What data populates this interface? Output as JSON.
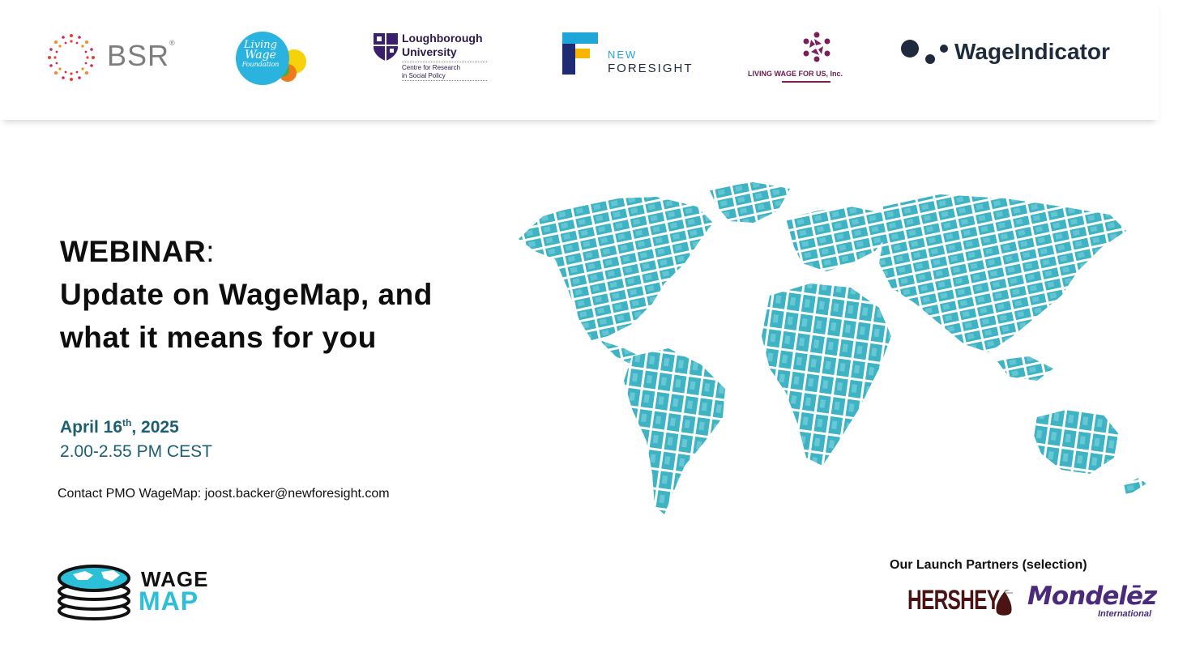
{
  "logos": {
    "bsr": {
      "text": "BSR",
      "mark": "®",
      "icon": "sunburst-dots-icon"
    },
    "living_wage_foundation": {
      "line1": "Living",
      "line2": "Wage",
      "line3": "Foundation"
    },
    "loughborough": {
      "name1": "Loughborough",
      "name2": "University",
      "sub1": "Centre for Research",
      "sub2": "in Social Policy",
      "icon": "crest-icon"
    },
    "new_foresight": {
      "new": "NEW",
      "foresight": "FORESIGHT",
      "icon": "f-mark-icon"
    },
    "living_wage_for_us": {
      "text": "LIVING WAGE FOR US, Inc.",
      "icon": "people-circle-icon"
    },
    "wage_indicator": {
      "text": "WageIndicator",
      "icon": "three-dots-icon"
    }
  },
  "headline": {
    "line1": "WEBINAR",
    "colon": ":",
    "line2": "Update on WageMap, and",
    "line3": "what it means for you"
  },
  "event": {
    "date_prefix": "April 16",
    "date_sup": "th",
    "date_suffix": ", 2025",
    "time": "2.00-2.55 PM CEST"
  },
  "contact": "Contact PMO WageMap: joost.backer@newforesight.com",
  "wagemap_logo": {
    "line1": "WAGE",
    "line2": "MAP",
    "icon": "globe-stack-icon"
  },
  "partners": {
    "label": "Our Launch Partners (selection)",
    "hershey": "HERSHEY",
    "mondelez": "Mondelēz",
    "mondelez_sub": "International"
  },
  "colors": {
    "teal_map": "#3db3c4",
    "date_blue": "#1c5e73",
    "wagemap_cyan": "#2cc0d8",
    "hershey_brown": "#4a1414",
    "mondelez_purple": "#4b2a7b"
  }
}
